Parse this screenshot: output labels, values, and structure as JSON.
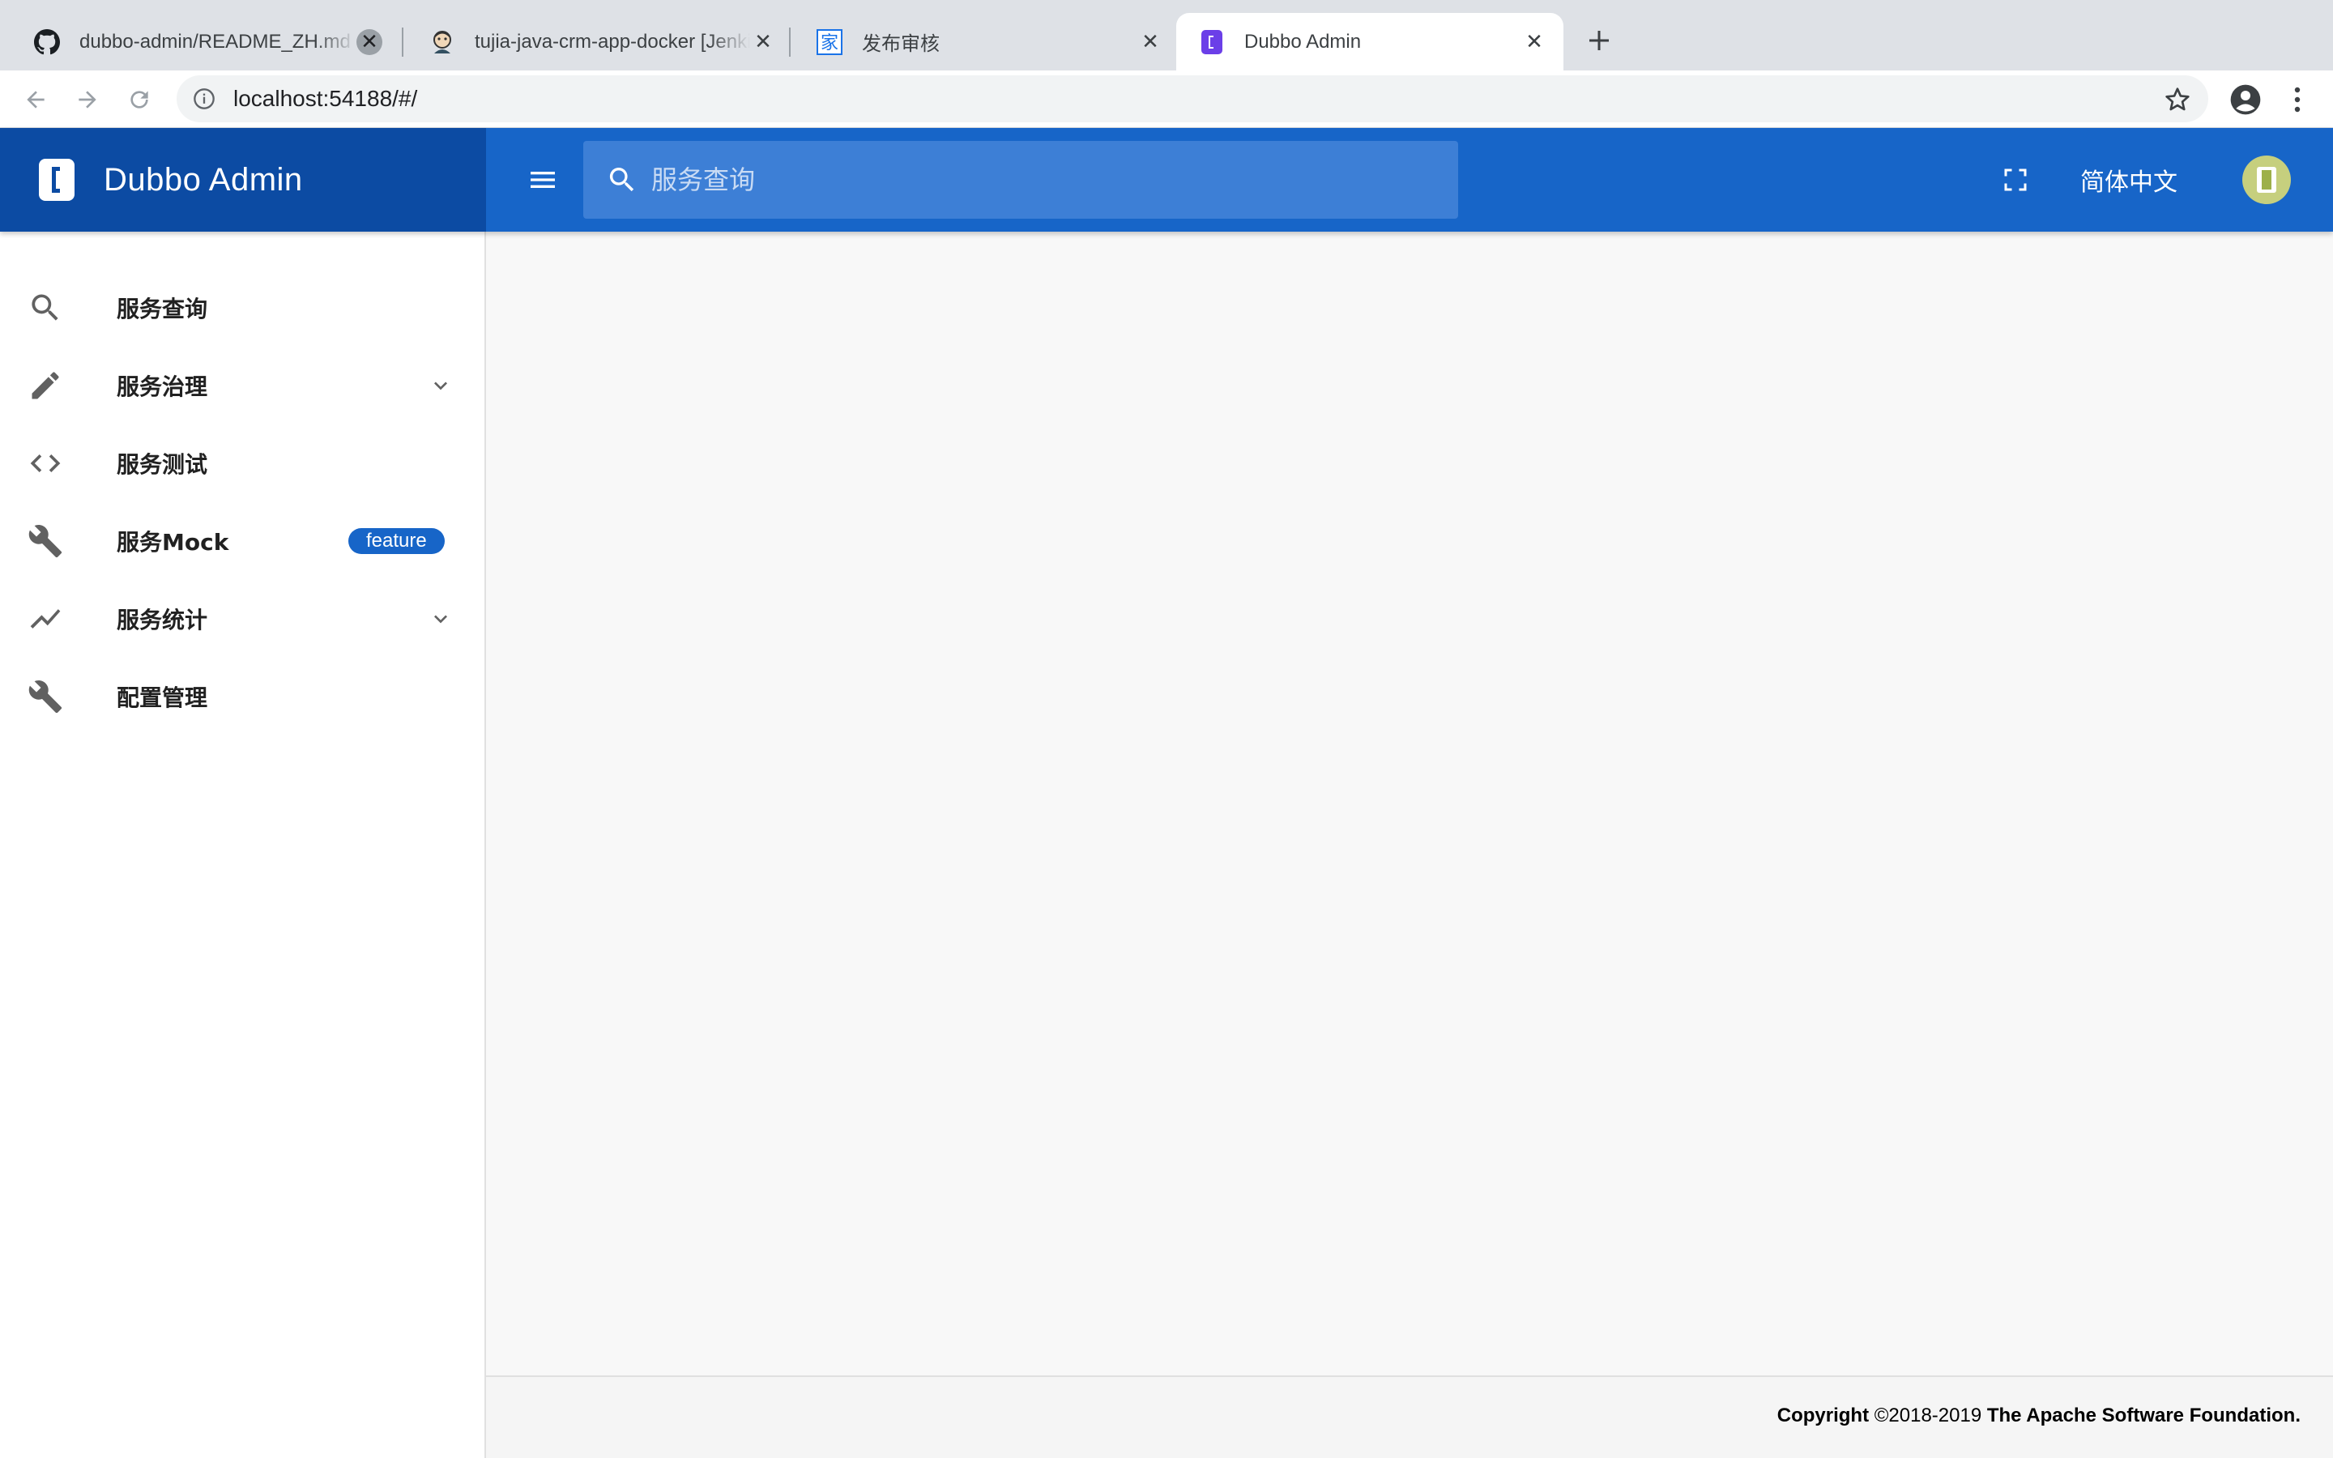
{
  "browser": {
    "tabs": [
      {
        "title": "dubbo-admin/README_ZH.md at",
        "favicon": "github-icon"
      },
      {
        "title": "tujia-java-crm-app-docker [Jenkins]",
        "favicon": "jenkins-icon"
      },
      {
        "title": "发布审核",
        "favicon": "jia-icon"
      },
      {
        "title": "Dubbo Admin",
        "favicon": "dubbo-icon"
      }
    ],
    "active_tab": 3,
    "url": "localhost:54188/#/"
  },
  "header": {
    "brand": "Dubbo Admin",
    "search_placeholder": "服务查询",
    "language": "简体中文"
  },
  "sidebar": {
    "items": [
      {
        "label": "服务查询",
        "icon": "search-icon"
      },
      {
        "label": "服务治理",
        "icon": "pencil-icon",
        "expandable": true
      },
      {
        "label": "服务测试",
        "icon": "code-icon"
      },
      {
        "label": "服务Mock",
        "icon": "wrench-icon",
        "badge": "feature"
      },
      {
        "label": "服务统计",
        "icon": "trending-up-icon",
        "expandable": true
      },
      {
        "label": "配置管理",
        "icon": "wrench-icon"
      }
    ]
  },
  "footer": {
    "copyright_prefix": "Copyright",
    "copyright_years": " ©2018-2019 ",
    "copyright_org": "The Apache Software Foundation."
  },
  "colors": {
    "header": "#1765c8",
    "brand_bg": "#0c4ba3",
    "badge": "#1765c8"
  }
}
